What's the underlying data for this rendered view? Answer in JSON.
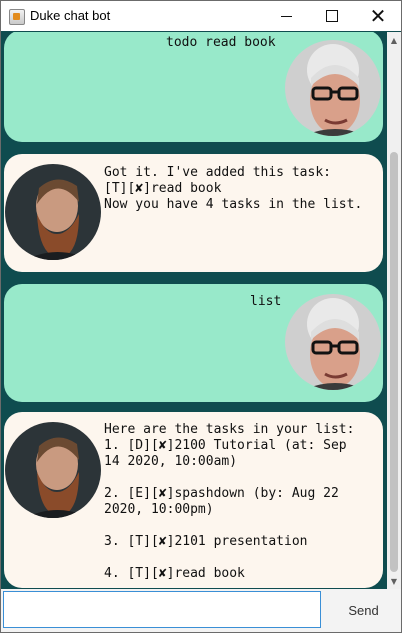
{
  "window": {
    "title": "Duke chat bot"
  },
  "messages": [
    {
      "sender": "user",
      "text": "todo read book"
    },
    {
      "sender": "bot",
      "text": "Got it. I've added this task:\n[T][✘]read book\nNow you have 4 tasks in the list."
    },
    {
      "sender": "user",
      "text": "list"
    },
    {
      "sender": "bot",
      "text": "Here are the tasks in your list:\n1. [D][✘]2100 Tutorial (at: Sep\n14 2020, 10:00am)\n\n2. [E][✘]spashdown (by: Aug 22\n2020, 10:00pm)\n\n3. [T][✘]2101 presentation\n\n4. [T][✘]read book"
    }
  ],
  "input": {
    "value": "",
    "placeholder": ""
  },
  "send_label": "Send",
  "colors": {
    "background": "#0f4c4f",
    "user_bubble": "#98e9ca",
    "bot_bubble": "#fdf6ee"
  }
}
